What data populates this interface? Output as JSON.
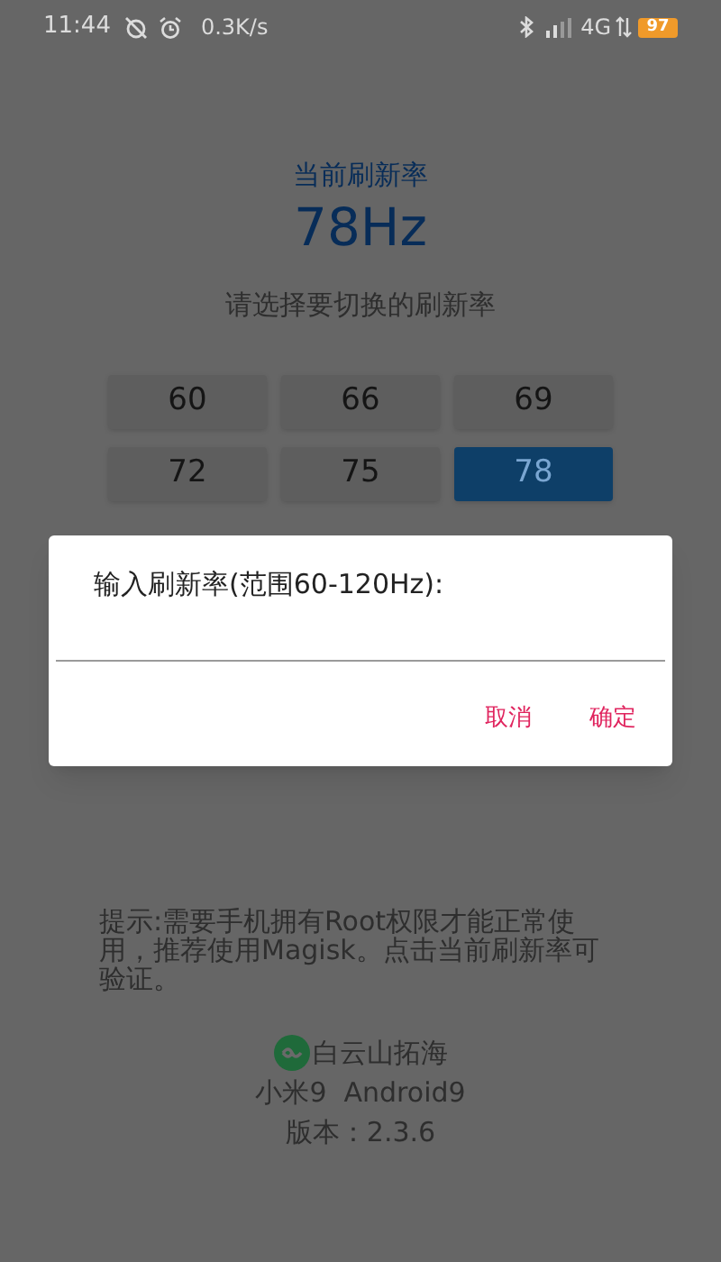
{
  "status_bar": {
    "time": "11:44",
    "net_speed": "0.3K/s",
    "network": "4G",
    "battery": "97"
  },
  "current": {
    "title": "当前刷新率",
    "value": "78Hz"
  },
  "prompt": "请选择要切换的刷新率",
  "rates": [
    {
      "label": "60",
      "selected": false
    },
    {
      "label": "66",
      "selected": false
    },
    {
      "label": "69",
      "selected": false
    },
    {
      "label": "72",
      "selected": false
    },
    {
      "label": "75",
      "selected": false
    },
    {
      "label": "78",
      "selected": true
    }
  ],
  "hint": "提示:需要手机拥有Root权限才能正常使用，推荐使用Magisk。点击当前刷新率可验证。",
  "brand": "白云山拓海",
  "device": "小米9  Android9",
  "version": "版本：2.3.6",
  "dialog": {
    "title": "输入刷新率(范围60-120Hz):",
    "buttons": [
      "取消",
      "确定"
    ]
  }
}
